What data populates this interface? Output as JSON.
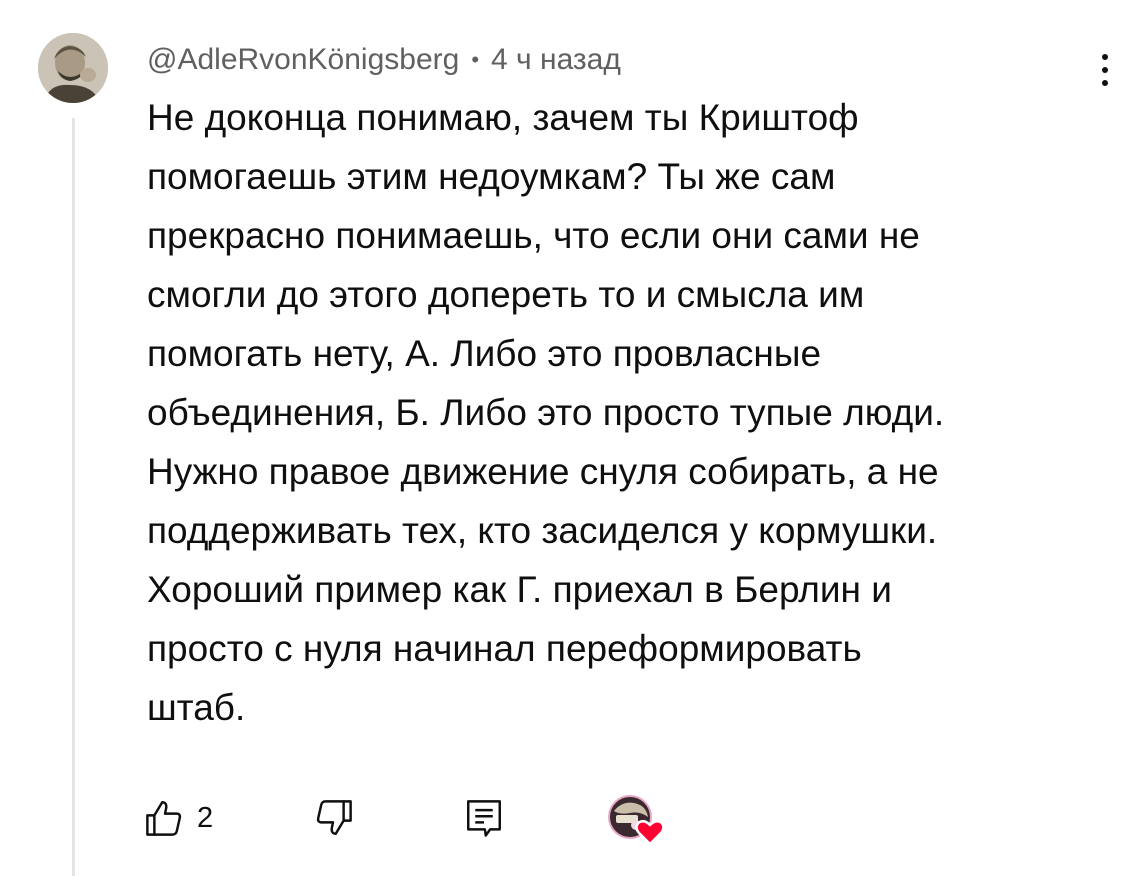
{
  "comment": {
    "author_handle": "@AdleRvonKönigsberg",
    "separator": "•",
    "timestamp": "4 ч назад",
    "text": "Не доконца понимаю, зачем ты Криштоф\nпомогаешь этим недоумкам? Ты же сам\nпрекрасно понимаешь, что если они сами не\nсмогли до этого доперeть то и смысла им\nпомогать нету, А. Либо это провласные\nобъединения, Б. Либо это просто тупые люди.\nНужно правое движение снуля собирать, а не\nподдерживать тех, кто засиделся у кормушки.\nХороший пример как Г. приехал в Берлин и\nпросто с нуля начинал переформировать\nштаб.",
    "like_count": "2"
  },
  "icons": {
    "more": "more-vertical-icon",
    "like": "thumbs-up-icon",
    "dislike": "thumbs-down-icon",
    "reply": "reply-comment-icon",
    "creator_heart": "creator-heart-icon"
  },
  "colors": {
    "meta_text": "#606060",
    "heart": "#ff0033",
    "thread_line": "#e5e5e5"
  }
}
